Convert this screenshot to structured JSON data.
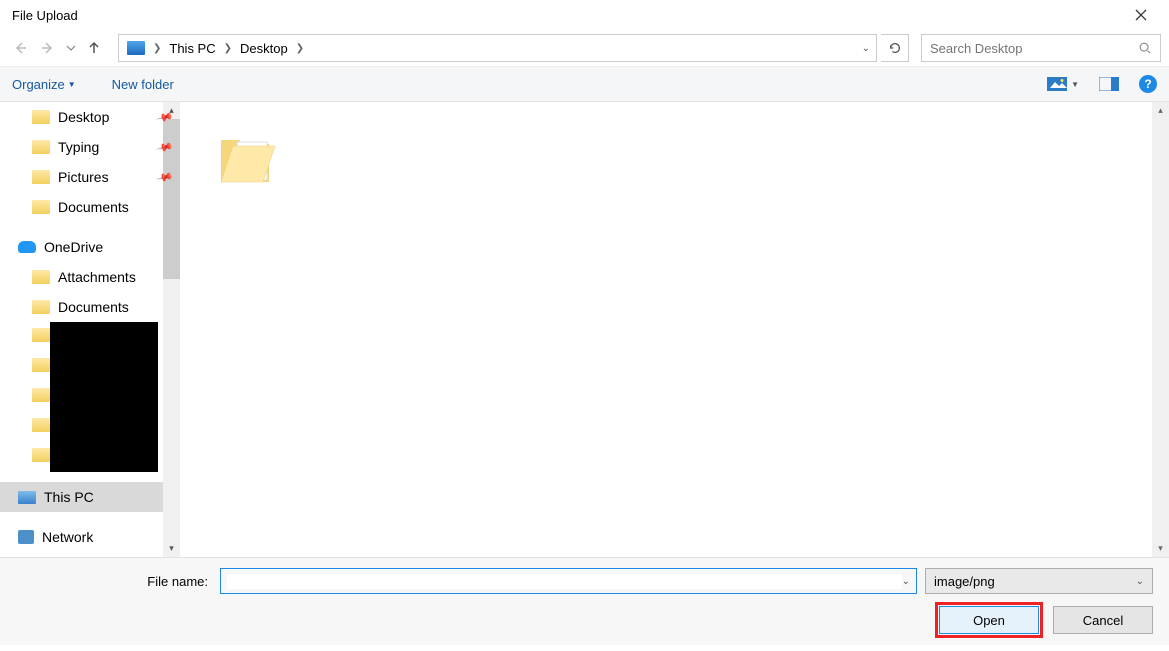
{
  "title": "File Upload",
  "breadcrumb": {
    "root": "This PC",
    "leaf": "Desktop"
  },
  "search": {
    "placeholder": "Search Desktop"
  },
  "orgbar": {
    "organize": "Organize",
    "newfolder": "New folder"
  },
  "sidebar": {
    "qa": [
      {
        "label": "Desktop",
        "pinned": true
      },
      {
        "label": "Typing",
        "pinned": true
      },
      {
        "label": "Pictures",
        "pinned": true
      },
      {
        "label": "Documents",
        "pinned": false
      }
    ],
    "onedrive": {
      "label": "OneDrive",
      "children": [
        "Attachments",
        "Documents"
      ]
    },
    "thispc": "This PC",
    "network": "Network"
  },
  "content": {
    "item0": ""
  },
  "footer": {
    "filename_label": "File name:",
    "filename_value": "",
    "filter": "image/png",
    "open": "Open",
    "cancel": "Cancel"
  }
}
